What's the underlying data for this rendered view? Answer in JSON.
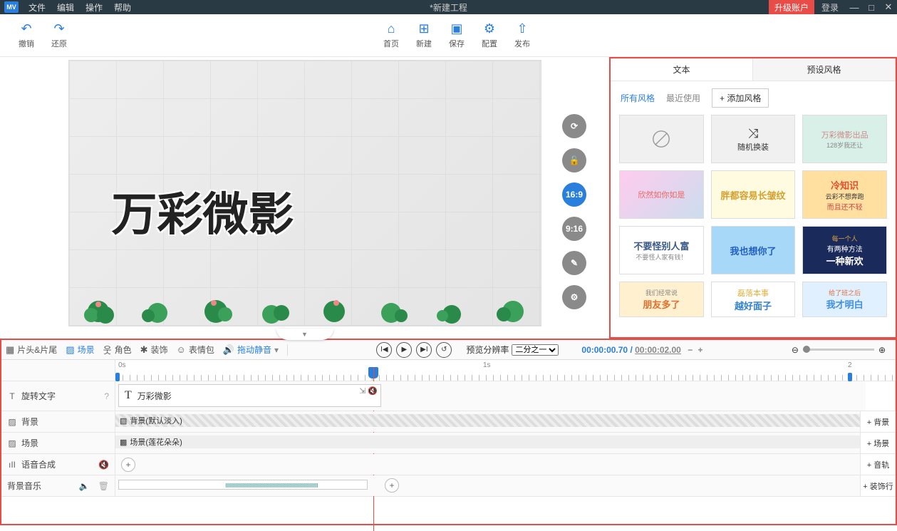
{
  "menu": {
    "logo": "MV",
    "items": [
      "文件",
      "编辑",
      "操作",
      "帮助"
    ],
    "title": "*新建工程",
    "upgrade": "升级账户",
    "login": "登录"
  },
  "toolbar": {
    "undo": "撤销",
    "redo": "还原",
    "home": "首页",
    "new": "新建",
    "save": "保存",
    "config": "配置",
    "publish": "发布"
  },
  "canvas": {
    "text": "万彩微影",
    "ratios": {
      "r169": "16:9",
      "r916": "9:16"
    }
  },
  "right_panel": {
    "tabs": {
      "text": "文本",
      "preset": "预设风格"
    },
    "sub": {
      "all": "所有风格",
      "recent": "最近使用",
      "add": "+ 添加风格"
    },
    "thumbs": {
      "random": "随机换装",
      "t3a": "万彩微影出品",
      "t3b": "128岁我还让",
      "t4": "欣然如你如是",
      "t5": "胖都容易长皱纹",
      "t6a": "冷知识",
      "t6b": "云彩不想奔跑",
      "t6c": "而且还不轻",
      "t7a": "不要怪别人富",
      "t7b": "不要怪人家有钱！",
      "t8": "我也想你了",
      "t9a": "每一个人",
      "t9b": "有两种方法",
      "t9c": "一种新欢",
      "t10a": "我们经常说",
      "t10b": "朋友多了",
      "t11a": "磊落本事",
      "t11b": "越好面子",
      "t12a": "给了班之后",
      "t12b": "我才明白"
    }
  },
  "timeline": {
    "tabs": {
      "head": "片头&片尾",
      "scene": "场景",
      "role": "角色",
      "decor": "装饰",
      "emoji": "表情包",
      "mute": "拖动静音"
    },
    "res_label": "预览分辨率",
    "res_value": "二分之一",
    "time_current": "00:00:00.70",
    "time_total": "00:00:02.00",
    "ruler": {
      "t0": "0s",
      "t1": "1s",
      "t2": "2"
    },
    "tracks": {
      "spin_text": "旋转文字",
      "text_clip": "万彩微影",
      "bg": "背景",
      "bg_clip": "背景(默认淡入)",
      "scene": "场景",
      "scene_clip": "场景(莲花朵朵)",
      "voice": "语音合成",
      "music": "背景音乐",
      "add_bg": "+ 背景",
      "add_scene": "+ 场景",
      "add_audio": "+ 音轨",
      "add_decor": "+ 装饰行"
    }
  }
}
